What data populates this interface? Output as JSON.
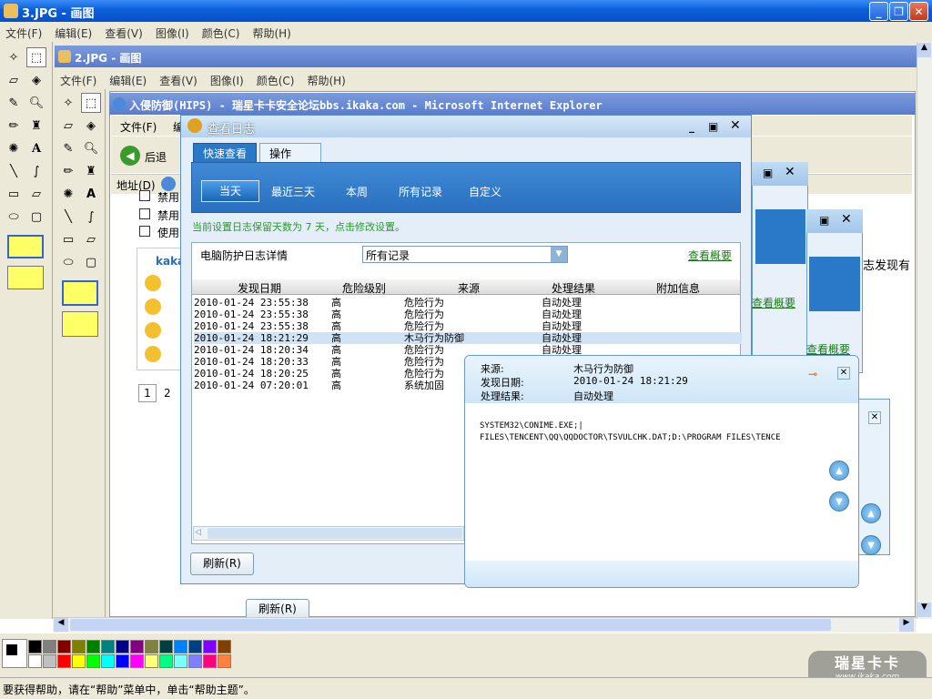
{
  "outer_window": {
    "title": "3.JPG - 画图",
    "menu": [
      "文件(F)",
      "编辑(E)",
      "查看(V)",
      "图像(I)",
      "颜色(C)",
      "帮助(H)"
    ]
  },
  "inner_window": {
    "title": "2.JPG - 画图",
    "menu": [
      "文件(F)",
      "编辑(E)",
      "查看(V)",
      "图像(I)",
      "颜色(C)",
      "帮助(H)"
    ]
  },
  "ie_window": {
    "title": "入侵防御(HIPS) - 瑞星卡卡安全论坛bbs.ikaka.com - Microsoft Internet Explorer",
    "menu_file": "文件(F)",
    "menu_edit": "编",
    "back": "后退",
    "address": "地址(D)",
    "checkbox1": "禁用",
    "checkbox2": "禁用",
    "checkbox3": "使用",
    "kaka": "kaka",
    "page1": "1",
    "page2": "2",
    "side_text": "志发现有",
    "side_link1": "查看概要",
    "side_link2": "查看概要",
    "bottom_refresh": "刷新(R)"
  },
  "log_dialog": {
    "title": "查看日志",
    "tabs": [
      "快速查看",
      "操作"
    ],
    "filters": [
      "当天",
      "最近三天",
      "本周",
      "所有记录",
      "自定义"
    ],
    "notice": "当前设置日志保留天数为 7 天，点击修改设置。",
    "detail_label": "电脑防护日志详情",
    "select_value": "所有记录",
    "summary_link": "查看概要",
    "columns": [
      "发现日期",
      "危险级别",
      "来源",
      "处理结果",
      "附加信息"
    ],
    "rows": [
      [
        "2010-01-24 23:55:38",
        "高",
        "危险行为",
        "自动处理",
        ""
      ],
      [
        "2010-01-24 23:55:38",
        "高",
        "危险行为",
        "自动处理",
        ""
      ],
      [
        "2010-01-24 23:55:38",
        "高",
        "危险行为",
        "自动处理",
        ""
      ],
      [
        "2010-01-24 18:21:29",
        "高",
        "木马行为防御",
        "自动处理",
        ""
      ],
      [
        "2010-01-24 18:20:34",
        "高",
        "危险行为",
        "自动处理",
        ""
      ],
      [
        "2010-01-24 18:20:33",
        "高",
        "危险行为",
        "自动处理",
        ""
      ],
      [
        "2010-01-24 18:20:25",
        "高",
        "危险行为",
        "自动处理",
        ""
      ],
      [
        "2010-01-24 07:20:01",
        "高",
        "系统加固",
        "自动处理",
        ""
      ]
    ],
    "refresh": "刷新(R)"
  },
  "popup": {
    "source_label": "来源:",
    "source_value": "木马行为防御",
    "date_label": "发现日期:",
    "date_value": "2010-01-24 18:21:29",
    "result_label": "处理结果:",
    "result_value": "自动处理",
    "line1": "SYSTEM32\\CONIME.EXE;|",
    "line2": "FILES\\TENCENT\\QQ\\QQDOCTOR\\TSVULCHK.DAT;D:\\PROGRAM FILES\\TENCE"
  },
  "status_bar": "要获得帮助，请在“帮助”菜单中，单击“帮助主题”。",
  "watermark": {
    "brand": "瑞星卡卡",
    "url": "www.ikaka.com"
  },
  "palette_top": [
    "#000000",
    "#808080",
    "#800000",
    "#808000",
    "#008000",
    "#008080",
    "#000080",
    "#800080",
    "#808040",
    "#004040",
    "#0080ff",
    "#004080",
    "#8000ff",
    "#804000"
  ],
  "palette_bottom": [
    "#ffffff",
    "#c0c0c0",
    "#ff0000",
    "#ffff00",
    "#00ff00",
    "#00ffff",
    "#0000ff",
    "#ff00ff",
    "#ffff80",
    "#00ff80",
    "#80ffff",
    "#8080ff",
    "#ff0080",
    "#ff8040"
  ]
}
